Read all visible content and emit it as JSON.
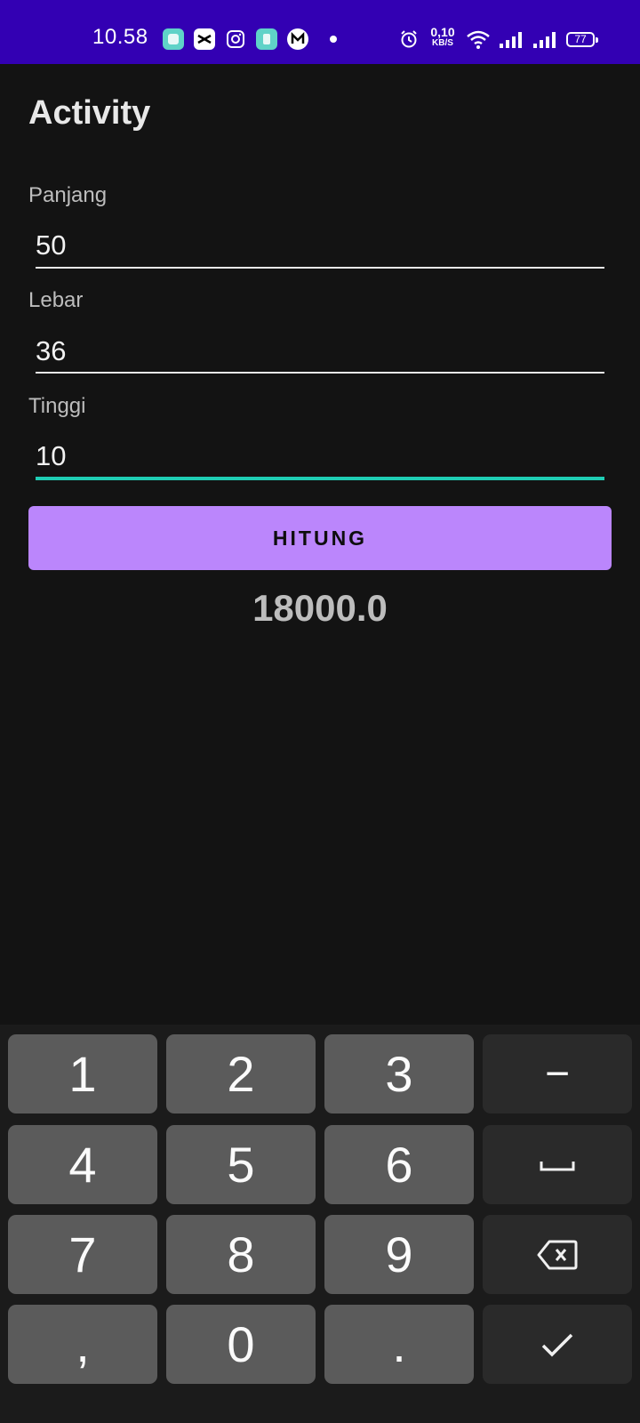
{
  "status_bar": {
    "time": "10.58",
    "net_speed_value": "0,10",
    "net_speed_unit": "KB/S",
    "battery": "77",
    "background": "#3300b3",
    "icons": [
      "gallery-app-icon",
      "capcut-icon",
      "instagram-icon",
      "app-icon",
      "mobile-legends-icon",
      "notification-dot",
      "alarm-icon",
      "wifi-icon",
      "signal-icon",
      "signal-icon",
      "battery-icon"
    ]
  },
  "app": {
    "title": "Activity",
    "fields": [
      {
        "label": "Panjang",
        "value": "50",
        "focused": false
      },
      {
        "label": "Lebar",
        "value": "36",
        "focused": false
      },
      {
        "label": "Tinggi",
        "value": "10",
        "focused": true
      }
    ],
    "button_label": "HITUNG",
    "result": "18000.0",
    "colors": {
      "accent": "#bb86fc",
      "focus_underline": "#1fcdb4",
      "background": "#131313"
    }
  },
  "keyboard": {
    "keys": [
      "1",
      "2",
      "3",
      "−",
      "4",
      "5",
      "6",
      "space",
      "7",
      "8",
      "9",
      "backspace",
      ",",
      "0",
      ".",
      "done"
    ],
    "digit_1": "1",
    "digit_2": "2",
    "digit_3": "3",
    "digit_4": "4",
    "digit_5": "5",
    "digit_6": "6",
    "digit_7": "7",
    "digit_8": "8",
    "digit_9": "9",
    "comma": ",",
    "digit_0": "0",
    "period": ".",
    "minus": "−",
    "func_icons": [
      "space-icon",
      "backspace-icon",
      "checkmark-icon"
    ]
  }
}
